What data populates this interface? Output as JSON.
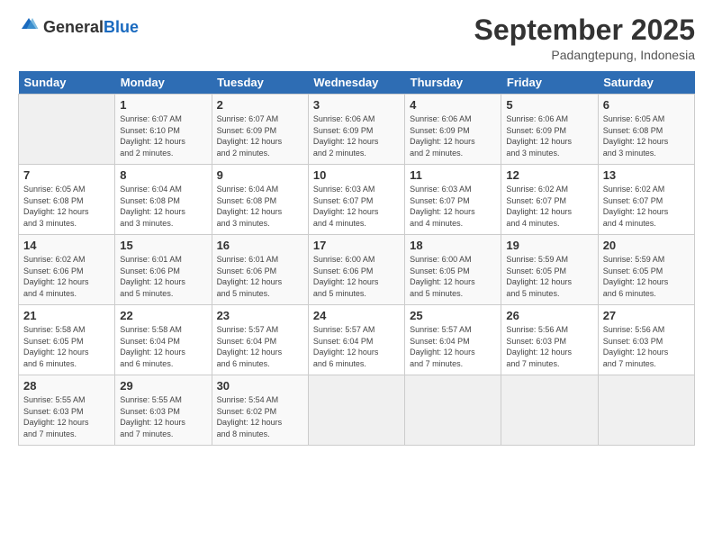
{
  "header": {
    "logo_general": "General",
    "logo_blue": "Blue",
    "month": "September 2025",
    "location": "Padangtepung, Indonesia"
  },
  "days_of_week": [
    "Sunday",
    "Monday",
    "Tuesday",
    "Wednesday",
    "Thursday",
    "Friday",
    "Saturday"
  ],
  "weeks": [
    [
      {
        "day": "",
        "info": ""
      },
      {
        "day": "1",
        "info": "Sunrise: 6:07 AM\nSunset: 6:10 PM\nDaylight: 12 hours\nand 2 minutes."
      },
      {
        "day": "2",
        "info": "Sunrise: 6:07 AM\nSunset: 6:09 PM\nDaylight: 12 hours\nand 2 minutes."
      },
      {
        "day": "3",
        "info": "Sunrise: 6:06 AM\nSunset: 6:09 PM\nDaylight: 12 hours\nand 2 minutes."
      },
      {
        "day": "4",
        "info": "Sunrise: 6:06 AM\nSunset: 6:09 PM\nDaylight: 12 hours\nand 2 minutes."
      },
      {
        "day": "5",
        "info": "Sunrise: 6:06 AM\nSunset: 6:09 PM\nDaylight: 12 hours\nand 3 minutes."
      },
      {
        "day": "6",
        "info": "Sunrise: 6:05 AM\nSunset: 6:08 PM\nDaylight: 12 hours\nand 3 minutes."
      }
    ],
    [
      {
        "day": "7",
        "info": "Sunrise: 6:05 AM\nSunset: 6:08 PM\nDaylight: 12 hours\nand 3 minutes."
      },
      {
        "day": "8",
        "info": "Sunrise: 6:04 AM\nSunset: 6:08 PM\nDaylight: 12 hours\nand 3 minutes."
      },
      {
        "day": "9",
        "info": "Sunrise: 6:04 AM\nSunset: 6:08 PM\nDaylight: 12 hours\nand 3 minutes."
      },
      {
        "day": "10",
        "info": "Sunrise: 6:03 AM\nSunset: 6:07 PM\nDaylight: 12 hours\nand 4 minutes."
      },
      {
        "day": "11",
        "info": "Sunrise: 6:03 AM\nSunset: 6:07 PM\nDaylight: 12 hours\nand 4 minutes."
      },
      {
        "day": "12",
        "info": "Sunrise: 6:02 AM\nSunset: 6:07 PM\nDaylight: 12 hours\nand 4 minutes."
      },
      {
        "day": "13",
        "info": "Sunrise: 6:02 AM\nSunset: 6:07 PM\nDaylight: 12 hours\nand 4 minutes."
      }
    ],
    [
      {
        "day": "14",
        "info": "Sunrise: 6:02 AM\nSunset: 6:06 PM\nDaylight: 12 hours\nand 4 minutes."
      },
      {
        "day": "15",
        "info": "Sunrise: 6:01 AM\nSunset: 6:06 PM\nDaylight: 12 hours\nand 5 minutes."
      },
      {
        "day": "16",
        "info": "Sunrise: 6:01 AM\nSunset: 6:06 PM\nDaylight: 12 hours\nand 5 minutes."
      },
      {
        "day": "17",
        "info": "Sunrise: 6:00 AM\nSunset: 6:06 PM\nDaylight: 12 hours\nand 5 minutes."
      },
      {
        "day": "18",
        "info": "Sunrise: 6:00 AM\nSunset: 6:05 PM\nDaylight: 12 hours\nand 5 minutes."
      },
      {
        "day": "19",
        "info": "Sunrise: 5:59 AM\nSunset: 6:05 PM\nDaylight: 12 hours\nand 5 minutes."
      },
      {
        "day": "20",
        "info": "Sunrise: 5:59 AM\nSunset: 6:05 PM\nDaylight: 12 hours\nand 6 minutes."
      }
    ],
    [
      {
        "day": "21",
        "info": "Sunrise: 5:58 AM\nSunset: 6:05 PM\nDaylight: 12 hours\nand 6 minutes."
      },
      {
        "day": "22",
        "info": "Sunrise: 5:58 AM\nSunset: 6:04 PM\nDaylight: 12 hours\nand 6 minutes."
      },
      {
        "day": "23",
        "info": "Sunrise: 5:57 AM\nSunset: 6:04 PM\nDaylight: 12 hours\nand 6 minutes."
      },
      {
        "day": "24",
        "info": "Sunrise: 5:57 AM\nSunset: 6:04 PM\nDaylight: 12 hours\nand 6 minutes."
      },
      {
        "day": "25",
        "info": "Sunrise: 5:57 AM\nSunset: 6:04 PM\nDaylight: 12 hours\nand 7 minutes."
      },
      {
        "day": "26",
        "info": "Sunrise: 5:56 AM\nSunset: 6:03 PM\nDaylight: 12 hours\nand 7 minutes."
      },
      {
        "day": "27",
        "info": "Sunrise: 5:56 AM\nSunset: 6:03 PM\nDaylight: 12 hours\nand 7 minutes."
      }
    ],
    [
      {
        "day": "28",
        "info": "Sunrise: 5:55 AM\nSunset: 6:03 PM\nDaylight: 12 hours\nand 7 minutes."
      },
      {
        "day": "29",
        "info": "Sunrise: 5:55 AM\nSunset: 6:03 PM\nDaylight: 12 hours\nand 7 minutes."
      },
      {
        "day": "30",
        "info": "Sunrise: 5:54 AM\nSunset: 6:02 PM\nDaylight: 12 hours\nand 8 minutes."
      },
      {
        "day": "",
        "info": ""
      },
      {
        "day": "",
        "info": ""
      },
      {
        "day": "",
        "info": ""
      },
      {
        "day": "",
        "info": ""
      }
    ]
  ]
}
